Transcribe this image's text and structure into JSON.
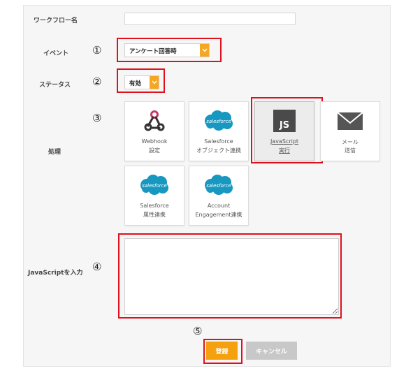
{
  "form": {
    "workflow_name_label": "ワークフロー名",
    "workflow_name_value": "",
    "event_label": "イベント",
    "event_value": "アンケート回答時",
    "status_label": "ステータス",
    "status_value": "有効",
    "process_label": "処理",
    "js_input_label": "JavaScriptを入力",
    "js_input_value": ""
  },
  "markers": {
    "m1": "①",
    "m2": "②",
    "m3": "③",
    "m4": "④",
    "m5": "⑤"
  },
  "cards": [
    {
      "icon": "webhook-icon",
      "line1": "Webhook",
      "line2": "設定"
    },
    {
      "icon": "salesforce-logo",
      "logo_text": "salesforce",
      "line1": "Salesforce",
      "line2": "オブジェクト連携"
    },
    {
      "icon": "javascript-icon",
      "logo_text": "JS",
      "line1": "JavaScript",
      "line2": "実行",
      "selected": true
    },
    {
      "icon": "mail-icon",
      "line1": "メール",
      "line2": "送信"
    },
    {
      "icon": "salesforce-logo",
      "logo_text": "salesforce",
      "line1": "Salesforce",
      "line2": "属性連携"
    },
    {
      "icon": "salesforce-logo",
      "logo_text": "salesforce",
      "line1": "Account",
      "line2": "Engagement連携"
    }
  ],
  "buttons": {
    "submit": "登録",
    "cancel": "キャンセル"
  },
  "colors": {
    "accent": "#f5a623",
    "highlight": "#e0101c",
    "salesforce": "#1798c1",
    "js_tile": "#4a4a4a",
    "mail": "#555555",
    "webhook": "#333333",
    "webhook_accent": "#c73a63"
  }
}
